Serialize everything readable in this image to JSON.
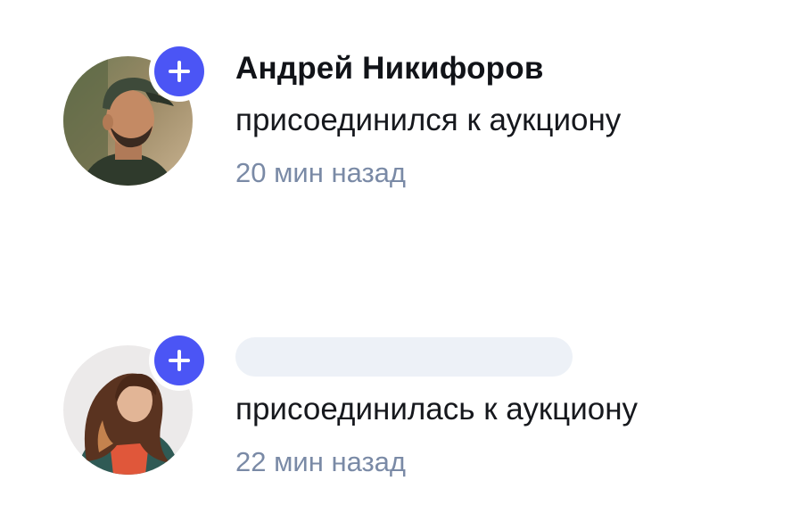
{
  "activity_feed": {
    "items": [
      {
        "user_name": "Андрей Никифоров",
        "action": "присоединился к аукциону",
        "time": "20 мин назад",
        "avatar_icon": "user-avatar-man-cap",
        "badge_icon": "plus-icon"
      },
      {
        "user_name": "",
        "action": "присоединилась к аукциону",
        "time": "22 мин назад",
        "avatar_icon": "user-avatar-woman",
        "badge_icon": "plus-icon"
      }
    ]
  },
  "colors": {
    "accent": "#4b55f5",
    "name_text": "#111318",
    "body_text": "#16181d",
    "time_text": "#7a8aa6",
    "placeholder": "#edf1f7"
  }
}
